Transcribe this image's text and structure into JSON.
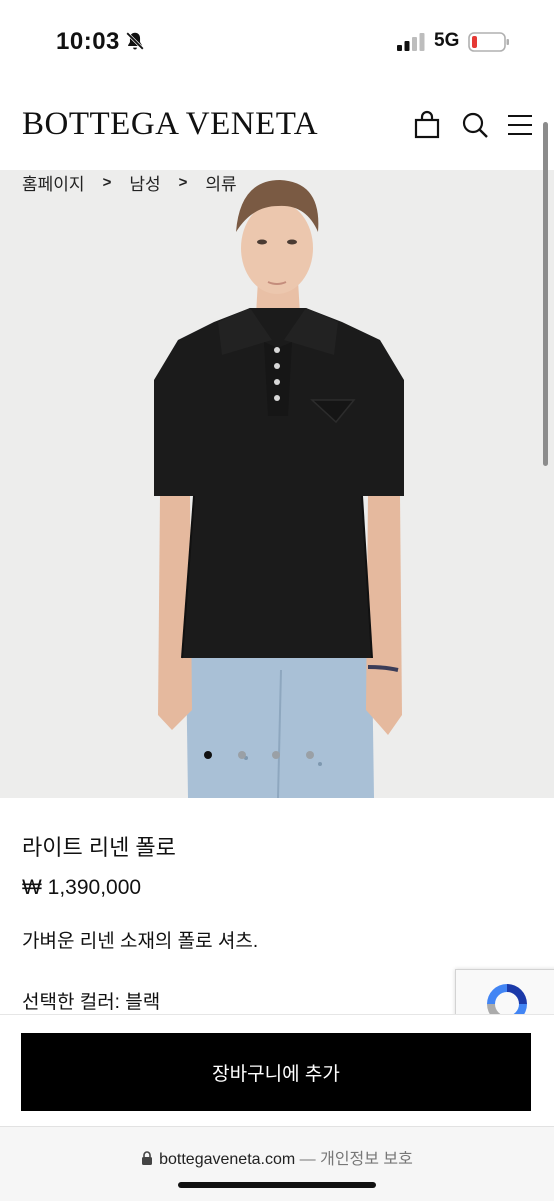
{
  "status_bar": {
    "time": "10:03",
    "network": "5G",
    "icons": [
      "bell-slash-icon",
      "signal-icon",
      "battery-icon"
    ],
    "battery_color": "#e53935"
  },
  "header": {
    "logo": "BOTTEGA VENETA",
    "icons": [
      "shopping-bag-icon",
      "search-icon",
      "menu-icon"
    ]
  },
  "breadcrumb": {
    "items": [
      "홈페이지",
      "남성",
      "의류"
    ],
    "separator": ">"
  },
  "gallery": {
    "image": "black-knit-polo-shirt-photo",
    "dot_count": 4,
    "active_index": 0
  },
  "product": {
    "name": "라이트 리넨 폴로",
    "price": "₩ 1,390,000",
    "description": "가벼운 리넨 소재의 폴로 셔츠.",
    "color_label": "선택한 컬러: 블랙"
  },
  "cta": {
    "add_to_cart_label": "장바구니에 추가"
  },
  "browser": {
    "domain": "bottegaveneta.com",
    "separator": "—",
    "privacy_label": "개인정보 보호"
  }
}
